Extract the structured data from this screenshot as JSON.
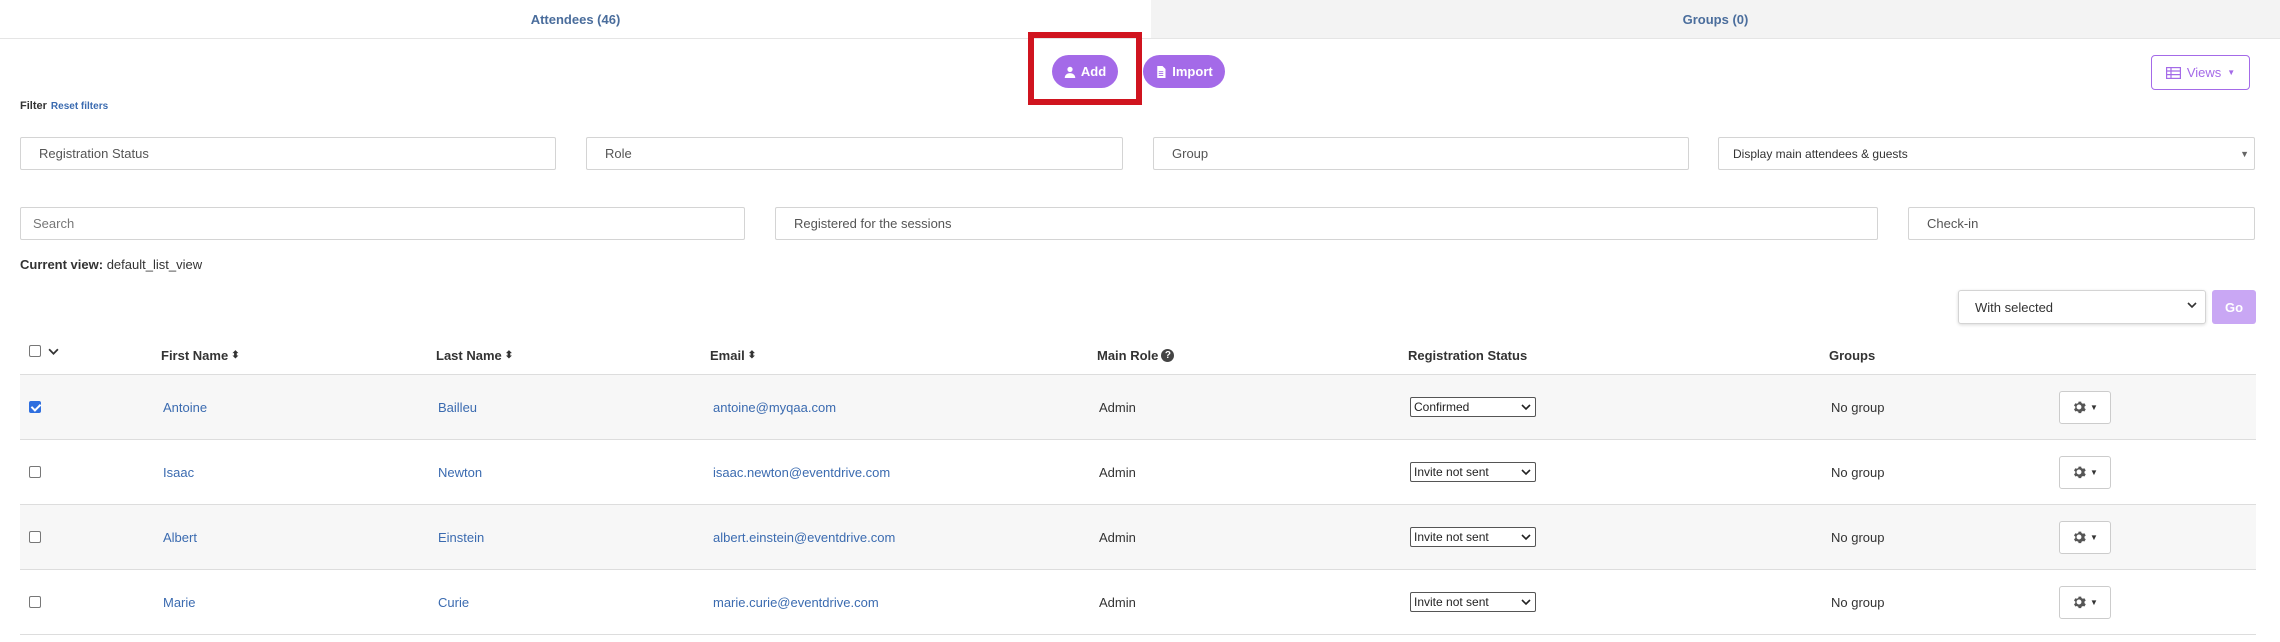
{
  "tabs": [
    {
      "label": "Attendees (46)"
    },
    {
      "label": "Groups (0)"
    }
  ],
  "actions": {
    "add_label": "Add",
    "import_label": "Import",
    "views_label": "Views"
  },
  "filter": {
    "label": "Filter",
    "reset_label": "Reset filters",
    "registration_status_placeholder": "Registration Status",
    "role_placeholder": "Role",
    "group_placeholder": "Group",
    "display_value": "Display main attendees & guests",
    "search_placeholder": "Search",
    "sessions_placeholder": "Registered for the sessions",
    "checkin_placeholder": "Check-in"
  },
  "current_view": {
    "label": "Current view:",
    "value": "default_list_view"
  },
  "bulk": {
    "with_selected": "With selected",
    "go_label": "Go"
  },
  "table": {
    "headers": {
      "first_name": "First Name",
      "last_name": "Last Name",
      "email": "Email",
      "main_role": "Main Role",
      "registration_status": "Registration Status",
      "groups": "Groups"
    },
    "rows": [
      {
        "checked": true,
        "first": "Antoine",
        "last": "Bailleu",
        "email": "antoine@myqaa.com",
        "role": "Admin",
        "status": "Confirmed",
        "groups": "No group"
      },
      {
        "checked": false,
        "first": "Isaac",
        "last": "Newton",
        "email": "isaac.newton@eventdrive.com",
        "role": "Admin",
        "status": "Invite not sent",
        "groups": "No group"
      },
      {
        "checked": false,
        "first": "Albert",
        "last": "Einstein",
        "email": "albert.einstein@eventdrive.com",
        "role": "Admin",
        "status": "Invite not sent",
        "groups": "No group"
      },
      {
        "checked": false,
        "first": "Marie",
        "last": "Curie",
        "email": "marie.curie@eventdrive.com",
        "role": "Admin",
        "status": "Invite not sent",
        "groups": "No group"
      }
    ]
  },
  "colors": {
    "accent": "#a46ae8",
    "link": "#3b6bb0",
    "highlight": "#d0141f"
  }
}
